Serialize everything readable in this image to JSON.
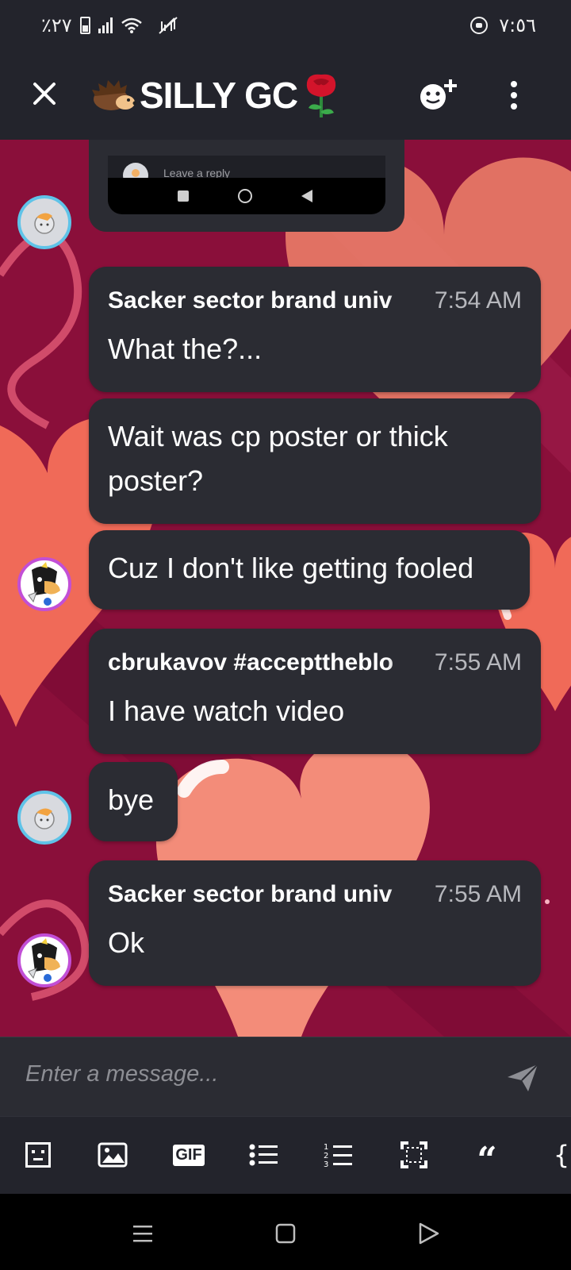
{
  "status_bar": {
    "battery_text": "٪٢٧",
    "clock": "٧:٥٦"
  },
  "header": {
    "title": "SILLY GC",
    "icons": [
      "close-icon",
      "hedgehog-emoji",
      "rose-emoji",
      "add-member-icon",
      "more-options-icon"
    ]
  },
  "embed": {
    "reply_placeholder": "Leave a reply"
  },
  "messages": [
    {
      "author": "Sacker sector brand univ",
      "time": "7:54 AM",
      "text": "What the?..."
    },
    {
      "author": "",
      "time": "",
      "text_lines": [
        "Wait was cp poster or thick",
        "poster?"
      ]
    },
    {
      "author": "",
      "time": "",
      "text": "Cuz I don't like getting fooled"
    },
    {
      "author": "cbrukavov #accepttheblo",
      "time": "7:55 AM",
      "text": "I have watch video"
    },
    {
      "author": "",
      "time": "",
      "text": "bye"
    },
    {
      "author": "Sacker sector brand univ",
      "time": "7:55 AM",
      "text": "Ok"
    }
  ],
  "composer": {
    "placeholder": "Enter a message..."
  },
  "toolbar": {
    "gif_label": "GIF",
    "quote_label": "“",
    "brace_label": "{"
  },
  "colors": {
    "app_background": "#23242c",
    "bubble": "#2b2c33",
    "chat_wallpaper": "#8a0f3a",
    "heart": "#f0826b"
  }
}
